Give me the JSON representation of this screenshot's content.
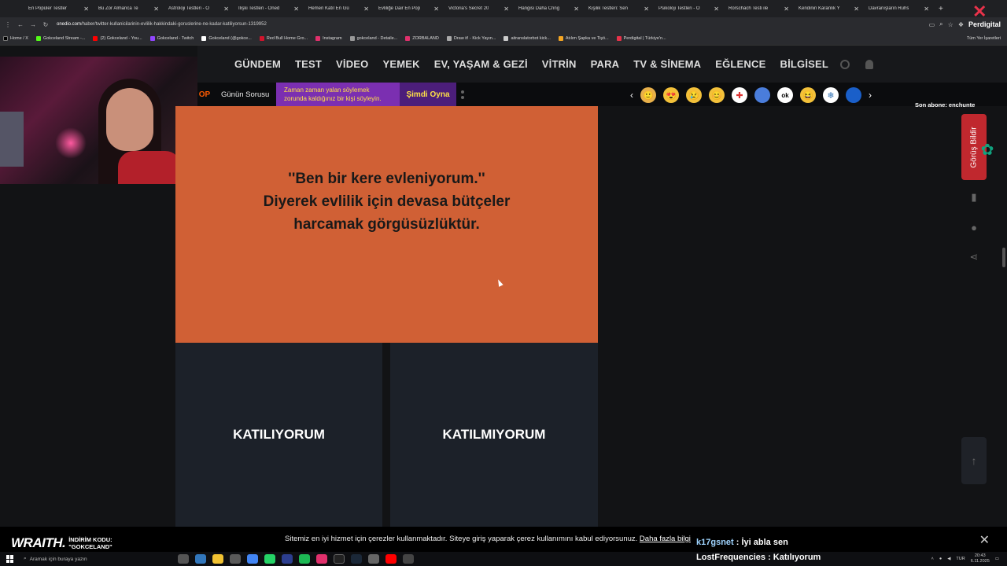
{
  "browser": {
    "tabs": [
      "En Popüler Testler",
      "Bu Zor Almanca Te",
      "Astroloji Testleri - O",
      "İlişki Testleri - Oned",
      "Hemen Katıl En Gü",
      "Evliliğe Dair En Pop",
      "Victoria's Secret 20",
      "Hangisi Daha Cring",
      "Kişilik Testleri: Sen",
      "Psikoloji Testleri - O",
      "Rorschach Testi ile",
      "Kendinin Karanlık Y",
      "Davranışların Ruhs"
    ],
    "url_host": "onedio.com",
    "url_path": "/haber/twitter-kullanicilarinin-evlilik-hakkindaki-goruslerine-ne-kadar-katiliyorsun-1319952",
    "profile_label": "Perdigital",
    "bookmarks": [
      "Home / X",
      "Gokceland Stream -...",
      "(2) Gokceland - You...",
      "Gokceland - Twitch",
      "Gokceland (@gokce...",
      "Red Bull Home Gro...",
      "Instagram",
      "gokceland - Detaile...",
      "ZORBALAND",
      "Draw it! - Kick Yayın...",
      "aitranslatorbot kick...",
      "Atılım Şapka ve Tişö...",
      "Perdigital | Türkiye'n..."
    ],
    "bookmarks_right": "Tüm Yer İşaretleri"
  },
  "site": {
    "nav": [
      "GÜNDEM",
      "TEST",
      "VİDEO",
      "YEMEK",
      "EV, YAŞAM & GEZİ",
      "VİTRİN",
      "PARA",
      "TV & SİNEMA",
      "EĞLENCE",
      "BİLGİSEL"
    ],
    "quiz": {
      "badge": "OP",
      "label": "Günün Sorusu",
      "question": "Zaman zaman yalan söylemek zorunda kaldığınız bir kişi söyleyin.",
      "play": "Şimdi Oyna"
    },
    "emojis": [
      "🙂",
      "😍",
      "😢",
      "😊",
      "✚",
      "⬤",
      "ok",
      "😆",
      "❄",
      "⬤"
    ],
    "subscriber": "Son abone: enchunte",
    "quote_card": {
      "line1": "''Ben bir kere evleniyorum.''",
      "line2": "Diyerek evlilik için devasa bütçeler",
      "line3": "harcamak görgüsüzlüktür."
    },
    "vote_yes": "KATILIYORUM",
    "vote_no": "KATILMIYORUM",
    "feedback_label": "Görüş Bildir",
    "cookie_text": "Sitemiz en iyi hizmet için çerezler kullanmaktadır. Siteye giriş yaparak çerez kullanımını kabul ediyorsunuz.",
    "cookie_link": "Daha fazla bilgi"
  },
  "stream": {
    "sponsor": "WRAITH.",
    "promo_label": "İNDİRİM KODU:",
    "promo_code": "\"GOKCELAND\"",
    "chat": [
      {
        "user": "k17gsnet",
        "text": " : İyi abla sen"
      },
      {
        "user": "LostFrequencies",
        "text": " : Katılıyorum"
      }
    ]
  },
  "taskbar": {
    "search_placeholder": "Aramak için buraya yazın",
    "lang": "TUR",
    "time": "20:43",
    "date": "6.11.2025"
  }
}
